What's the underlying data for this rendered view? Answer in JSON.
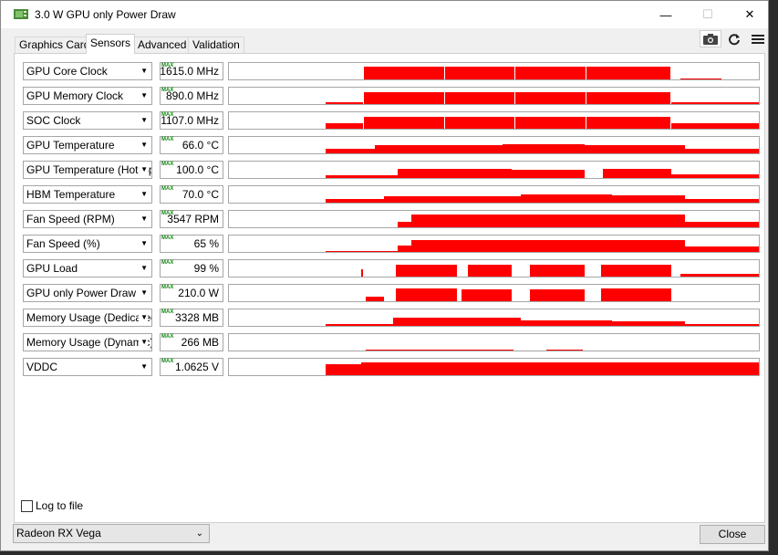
{
  "window": {
    "title": "3.0 W GPU only Power Draw",
    "controls": {
      "minimize": "—",
      "maximize": "☐",
      "close": "✕"
    }
  },
  "tabs": [
    {
      "label": "Graphics Card"
    },
    {
      "label": "Sensors",
      "active": true
    },
    {
      "label": "Advanced"
    },
    {
      "label": "Validation"
    }
  ],
  "toolbar": {
    "camera": "camera-icon",
    "refresh": "refresh-icon",
    "menu": "hamburger-menu-icon"
  },
  "graph_color": "#ff0000",
  "max_indicator": "MAX",
  "sensors": [
    {
      "name": "GPU Core Clock",
      "value": "1615.0 MHz"
    },
    {
      "name": "GPU Memory Clock",
      "value": "890.0 MHz"
    },
    {
      "name": "SOC Clock",
      "value": "1107.0 MHz"
    },
    {
      "name": "GPU Temperature",
      "value": "66.0 °C"
    },
    {
      "name": "GPU Temperature (Hot Spot)",
      "value": "100.0 °C"
    },
    {
      "name": "HBM Temperature",
      "value": "70.0 °C"
    },
    {
      "name": "Fan Speed (RPM)",
      "value": "3547 RPM"
    },
    {
      "name": "Fan Speed (%)",
      "value": "65 %"
    },
    {
      "name": "GPU Load",
      "value": "99 %"
    },
    {
      "name": "GPU only Power Draw",
      "value": "210.0 W"
    },
    {
      "name": "Memory Usage (Dedicated)",
      "value": "3328 MB"
    },
    {
      "name": "Memory Usage (Dynamic)",
      "value": "266 MB"
    },
    {
      "name": "VDDC",
      "value": "1.0625 V"
    }
  ],
  "log_to_file": {
    "label": "Log to file",
    "checked": false
  },
  "gpu_select": {
    "value": "Radeon RX Vega"
  },
  "close_button": {
    "label": "Close"
  }
}
